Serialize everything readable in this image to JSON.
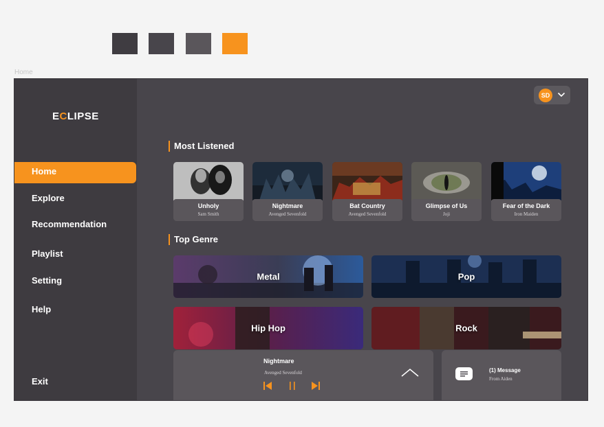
{
  "page_label": "Home",
  "colors": {
    "accent": "#f7931e",
    "background": "#48454b",
    "sidebar": "#3e3b40",
    "card": "#5a565b",
    "swatches": [
      "#3f3c41",
      "#48454b",
      "#5a565b",
      "#f7931e"
    ]
  },
  "app": {
    "logo_prefix": "E",
    "logo_accent": "C",
    "logo_suffix": "LIPSE"
  },
  "user": {
    "initials": "SD"
  },
  "sidebar": {
    "items": [
      {
        "label": "Home",
        "active": true
      },
      {
        "label": "Explore"
      },
      {
        "label": "Recommendation"
      },
      {
        "label": "Playlist"
      },
      {
        "label": "Setting"
      },
      {
        "label": "Help"
      }
    ],
    "exit_label": "Exit"
  },
  "most_listened": {
    "title": "Most Listened",
    "items": [
      {
        "title": "Unholy",
        "artist": "Sam Smith"
      },
      {
        "title": "Nightmare",
        "artist": "Avenged Sevenfold"
      },
      {
        "title": "Bat Country",
        "artist": "Avenged Sevenfold"
      },
      {
        "title": "Glimpse of Us",
        "artist": "Joji"
      },
      {
        "title": "Fear of the Dark",
        "artist": "Iron Maiden"
      }
    ]
  },
  "top_genre": {
    "title": "Top Genre",
    "items": [
      {
        "label": "Metal"
      },
      {
        "label": "Pop"
      },
      {
        "label": "Hip Hop"
      },
      {
        "label": "Rock"
      }
    ]
  },
  "player": {
    "title": "Nightmare",
    "artist": "Avenged Sevenfold",
    "icons": [
      "skip-back-icon",
      "pause-icon",
      "skip-forward-icon",
      "chevron-up-icon"
    ]
  },
  "message": {
    "title": "(1) Message",
    "from": "From Aiden",
    "icon": "message-icon"
  }
}
